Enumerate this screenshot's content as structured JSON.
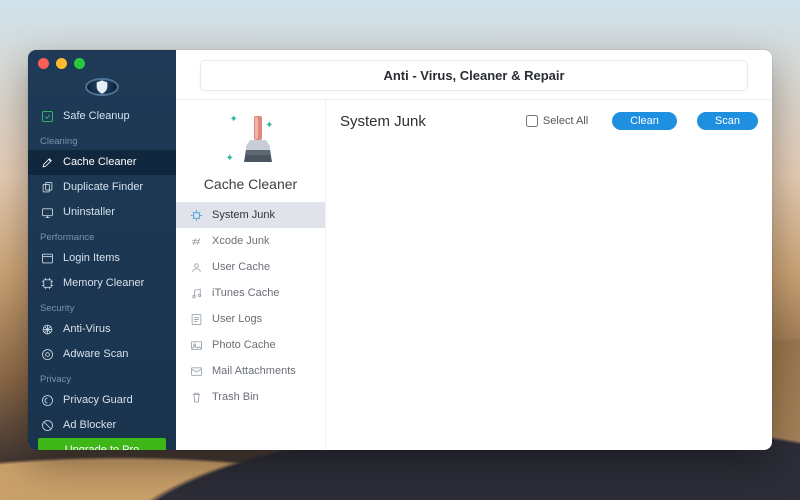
{
  "header": {
    "title": "Anti - Virus, Cleaner & Repair"
  },
  "sidebar": {
    "safe_cleanup": "Safe Cleanup",
    "groups": {
      "cleaning": "Cleaning",
      "performance": "Performance",
      "security": "Security",
      "privacy": "Privacy"
    },
    "items": {
      "cache_cleaner": "Cache Cleaner",
      "duplicate_finder": "Duplicate Finder",
      "uninstaller": "Uninstaller",
      "login_items": "Login Items",
      "memory_cleaner": "Memory Cleaner",
      "anti_virus": "Anti-Virus",
      "adware_scan": "Adware Scan",
      "privacy_guard": "Privacy Guard",
      "ad_blocker": "Ad Blocker"
    },
    "upgrade": "Upgrade to Pro"
  },
  "mid": {
    "title": "Cache Cleaner",
    "cats": {
      "system_junk": "System Junk",
      "xcode_junk": "Xcode Junk",
      "user_cache": "User Cache",
      "itunes_cache": "iTunes Cache",
      "user_logs": "User Logs",
      "photo_cache": "Photo Cache",
      "mail_attachments": "Mail Attachments",
      "trash_bin": "Trash Bin"
    }
  },
  "main": {
    "title": "System Junk",
    "select_all": "Select All",
    "clean": "Clean",
    "scan": "Scan"
  }
}
